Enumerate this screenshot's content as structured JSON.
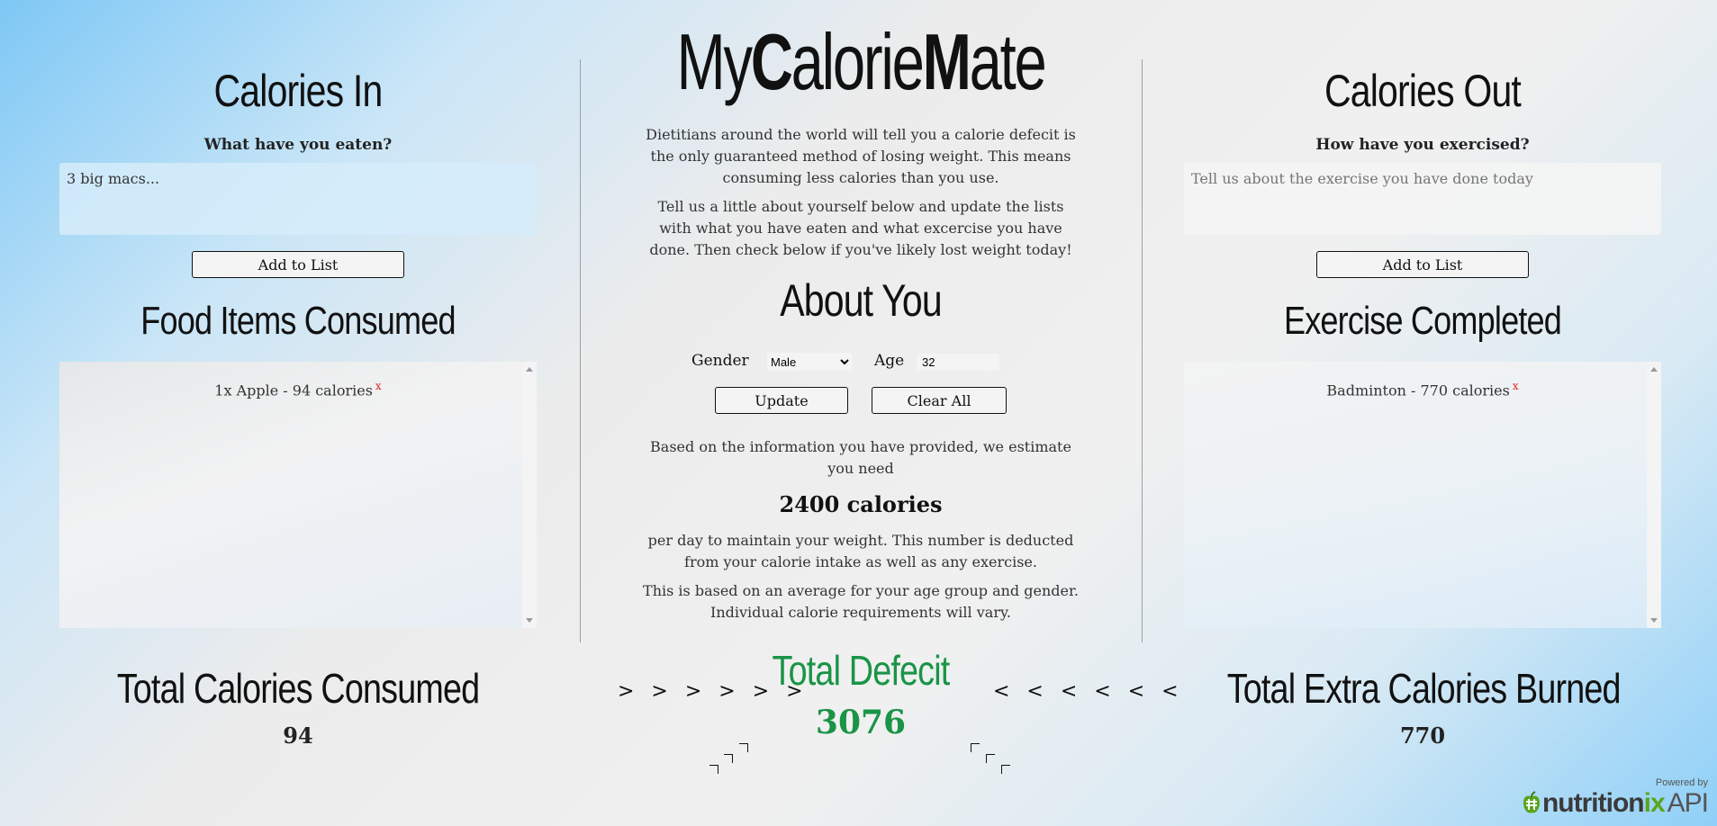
{
  "app": {
    "logo_part1": "My",
    "logo_part2": "C",
    "logo_part3": "alorie",
    "logo_part4": "M",
    "logo_part5": "ate",
    "intro_1": "Dietitians around the world will tell you a calorie defecit is the only guaranteed method of losing weight. This means consuming less calories than you use.",
    "intro_2": "Tell us a little about yourself below and update the lists with what you have eaten and what excercise you have done. Then check below if you've likely lost weight today!"
  },
  "calories_in": {
    "title": "Calories In",
    "question": "What have you eaten?",
    "input_value": "3 big macs...",
    "add_button": "Add to List",
    "list_title": "Food Items Consumed",
    "items": [
      {
        "label": "1x Apple - 94 calories",
        "remove": "x"
      }
    ],
    "total_title": "Total Calories Consumed",
    "total_value": "94"
  },
  "calories_out": {
    "title": "Calories Out",
    "question": "How have you exercised?",
    "input_placeholder": "Tell us about the exercise you have done today",
    "add_button": "Add to List",
    "list_title": "Exercise Completed",
    "items": [
      {
        "label": "Badminton - 770 calories",
        "remove": "x"
      }
    ],
    "total_title": "Total Extra Calories Burned",
    "total_value": "770"
  },
  "about": {
    "title": "About You",
    "gender_label": "Gender",
    "gender_value": "Male",
    "age_label": "Age",
    "age_value": "32",
    "update_button": "Update",
    "clear_button": "Clear All",
    "estimate_intro": "Based on the information you have provided, we estimate you need",
    "estimate_value": "2400 calories",
    "estimate_after": "per day to maintain your weight. This number is deducted from your calorie intake as well as any exercise.",
    "disclaimer": "This is based on an average for your age group and gender. Individual calorie requirements will vary."
  },
  "defecit": {
    "title": "Total Defecit",
    "value": "3076",
    "arrows_right": "> > > > > >",
    "arrows_left": "< < < < < <"
  },
  "powered": {
    "small": "Powered by",
    "brand_a": "nutrition",
    "brand_b": "ix",
    "brand_c": "API"
  },
  "colors": {
    "accent_green": "#1a9447",
    "remove_red": "#d22222",
    "brand_green": "#5aa51c"
  }
}
